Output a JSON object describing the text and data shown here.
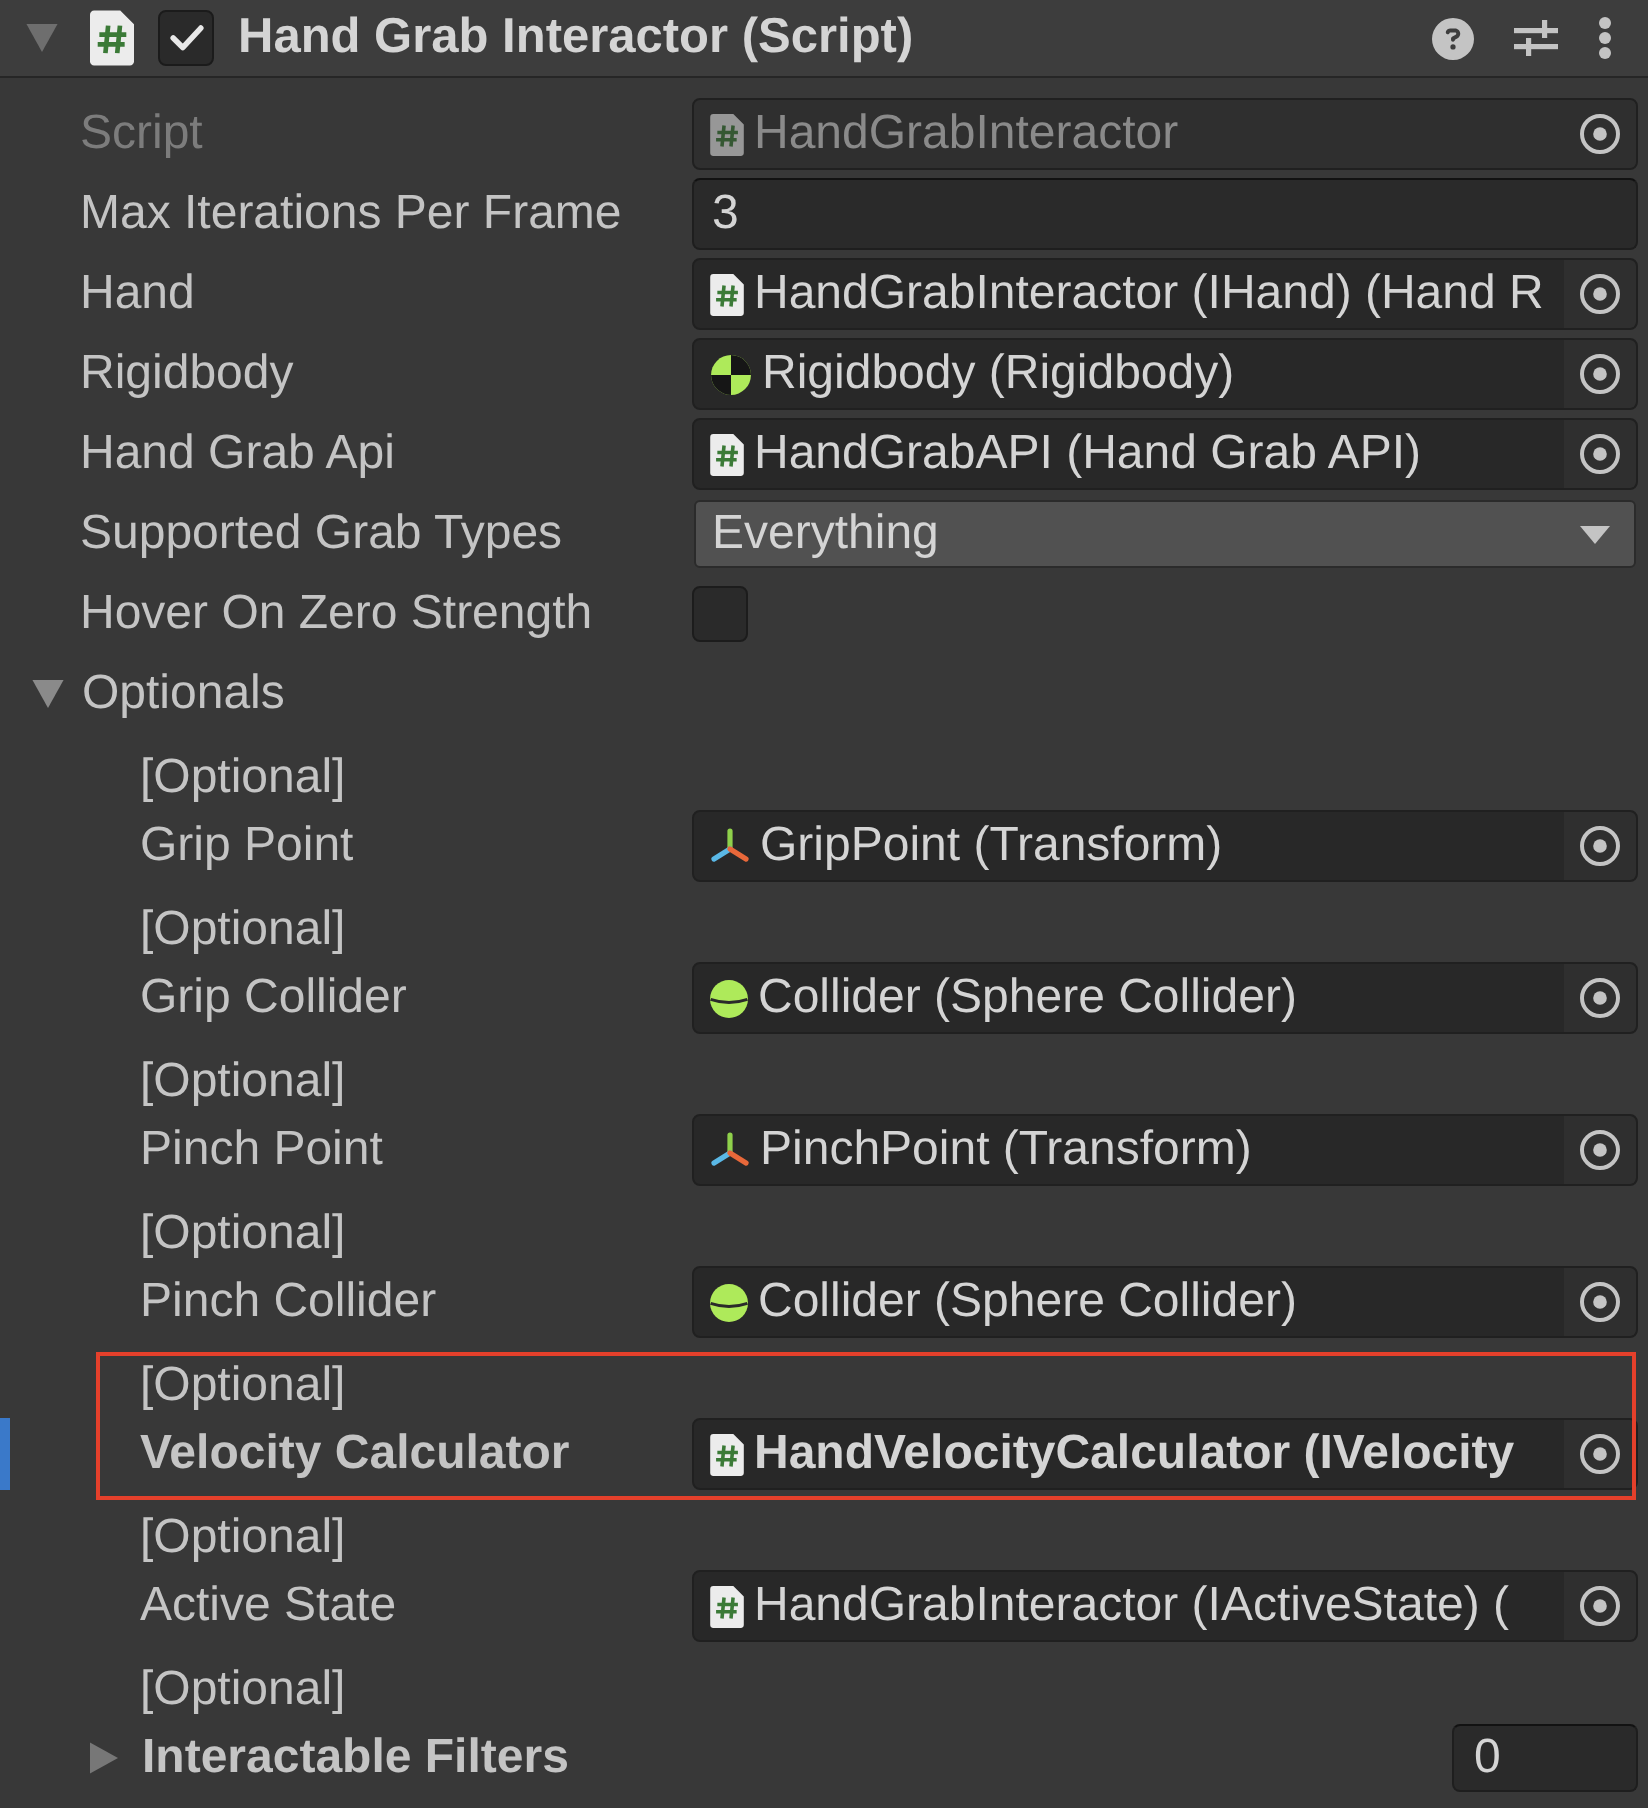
{
  "component": {
    "title": "Hand Grab Interactor (Script)",
    "enabled": true,
    "expanded": true
  },
  "properties": [
    {
      "label": "Script",
      "kind": "script",
      "value": "HandGrabInteractor",
      "disabled": true
    },
    {
      "label": "Max Iterations Per Frame",
      "kind": "number",
      "value": "3",
      "disabled": false
    },
    {
      "label": "Hand",
      "kind": "script",
      "value": "HandGrabInteractor (IHand) (Hand R",
      "disabled": false
    },
    {
      "label": "Rigidbody",
      "kind": "rigidbody",
      "value": "Rigidbody (Rigidbody)",
      "disabled": false
    },
    {
      "label": "Hand Grab Api",
      "kind": "script",
      "value": "HandGrabAPI (Hand Grab API)",
      "disabled": false
    },
    {
      "label": "Supported Grab Types",
      "kind": "dropdown",
      "value": "Everything",
      "disabled": false
    },
    {
      "label": "Hover On Zero Strength",
      "kind": "toggle",
      "checked": false,
      "disabled": false
    }
  ],
  "optionals": {
    "label": "Optionals",
    "expanded": true,
    "items": [
      {
        "note": "[Optional]",
        "label": "Grip Point",
        "kind": "transform",
        "value": "GripPoint (Transform)",
        "bold": false,
        "overridden": false,
        "highlighted": false
      },
      {
        "note": "[Optional]",
        "label": "Grip Collider",
        "kind": "collider",
        "value": "Collider (Sphere Collider)",
        "bold": false,
        "overridden": false,
        "highlighted": false
      },
      {
        "note": "[Optional]",
        "label": "Pinch Point",
        "kind": "transform",
        "value": "PinchPoint (Transform)",
        "bold": false,
        "overridden": false,
        "highlighted": false
      },
      {
        "note": "[Optional]",
        "label": "Pinch Collider",
        "kind": "collider",
        "value": "Collider (Sphere Collider)",
        "bold": false,
        "overridden": false,
        "highlighted": false
      },
      {
        "note": "[Optional]",
        "label": "Velocity Calculator",
        "kind": "script",
        "value": "HandVelocityCalculator (IVelocity",
        "bold": true,
        "overridden": true,
        "highlighted": true
      },
      {
        "note": "[Optional]",
        "label": "Active State",
        "kind": "script",
        "value": "HandGrabInteractor (IActiveState) (",
        "bold": false,
        "overridden": false,
        "highlighted": false
      },
      {
        "note": "[Optional]",
        "label": "Interactable Filters",
        "kind": "list",
        "expanded": false,
        "value": "0",
        "bold": true,
        "overridden": false,
        "highlighted": false
      }
    ]
  }
}
